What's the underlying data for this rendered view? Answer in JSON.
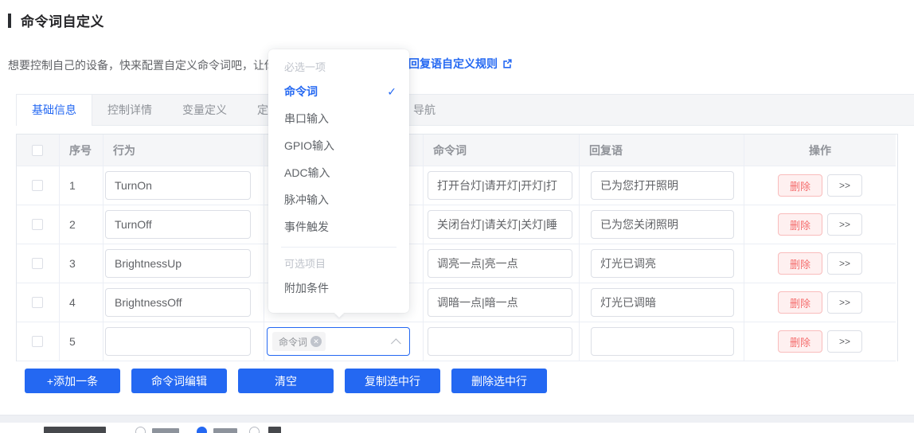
{
  "header": {
    "title": "命令词自定义",
    "description": "想要控制自己的设备，快来配置自定义命令词吧，让你",
    "rules_link": "回复语自定义规则"
  },
  "tabs": [
    {
      "label": "基础信息",
      "active": true
    },
    {
      "label": "控制详情",
      "active": false
    },
    {
      "label": "变量定义",
      "active": false
    },
    {
      "label": "定",
      "active": false,
      "note": "partially hidden by dropdown"
    },
    {
      "label": "导航",
      "active": false,
      "note": "partially hidden by dropdown"
    }
  ],
  "table": {
    "columns": {
      "index": "序号",
      "behavior": "行为",
      "trigger": "",
      "command": "命令词",
      "reply": "回复语",
      "actions": "操作"
    },
    "rows": [
      {
        "index": "1",
        "behavior": "TurnOn",
        "command": "打开台灯|请开灯|开灯|打",
        "reply": "已为您打开照明"
      },
      {
        "index": "2",
        "behavior": "TurnOff",
        "command": "关闭台灯|请关灯|关灯|睡",
        "reply": "已为您关闭照明"
      },
      {
        "index": "3",
        "behavior": "BrightnessUp",
        "command": "调亮一点|亮一点",
        "reply": "灯光已调亮"
      },
      {
        "index": "4",
        "behavior": "BrightnessOff",
        "command": "调暗一点|暗一点",
        "reply": "灯光已调暗"
      },
      {
        "index": "5",
        "behavior": "",
        "command": "",
        "reply": ""
      }
    ],
    "delete_label": "删除",
    "expand_label": ">>"
  },
  "trigger_select": {
    "tag": "命令词",
    "close_icon": "✕"
  },
  "dropdown": {
    "groups": [
      {
        "label": "必选一项",
        "options": [
          {
            "label": "命令词",
            "selected": true,
            "check": "✓"
          },
          {
            "label": "串口输入"
          },
          {
            "label": "GPIO输入"
          },
          {
            "label": "ADC输入"
          },
          {
            "label": "脉冲输入"
          },
          {
            "label": "事件触发"
          }
        ]
      },
      {
        "label": "可选项目",
        "options": [
          {
            "label": "附加条件"
          }
        ]
      }
    ]
  },
  "footer": {
    "buttons": [
      "+添加一条",
      "命令词编辑",
      "清空",
      "复制选中行",
      "删除选中行"
    ]
  },
  "colors": {
    "accent": "#2468F2",
    "danger": "#F56C6C",
    "danger_bg": "#FEF0F0",
    "tab_bar_bg": "#f4f5f7",
    "header_bg": "#f5f6f8"
  }
}
